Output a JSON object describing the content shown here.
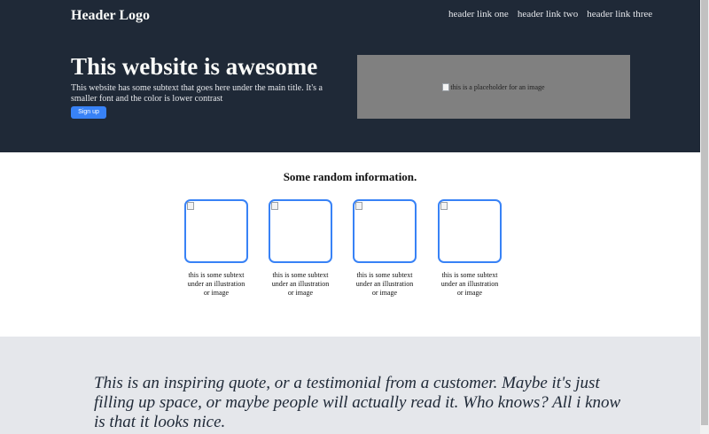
{
  "header": {
    "logo": "Header Logo",
    "nav": [
      "header link one",
      "header link two",
      "header link three"
    ]
  },
  "hero": {
    "title": "This website is awesome",
    "subtitle": "This website has some subtext that goes here under the main title. It's a smaller font and the color is lower contrast",
    "signup_label": "Sign up",
    "image_alt": "this is a placeholder for an image"
  },
  "info": {
    "title": "Some random information.",
    "cards": [
      {
        "text": "this is some subtext under an illustration or image"
      },
      {
        "text": "this is some subtext under an illustration or image"
      },
      {
        "text": "this is some subtext under an illustration or image"
      },
      {
        "text": "this is some subtext under an illustration or image"
      }
    ]
  },
  "quote": {
    "text": "This is an inspiring quote, or a testimonial from a customer. Maybe it's just filling up space, or maybe people will actually read it. Who knows? All i know is that it looks nice."
  },
  "colors": {
    "hero_bg": "#1f2937",
    "accent": "#3882f6",
    "quote_bg": "#e5e7eb",
    "image_placeholder": "#808080"
  },
  "icons": [
    "broken-image-icon"
  ]
}
